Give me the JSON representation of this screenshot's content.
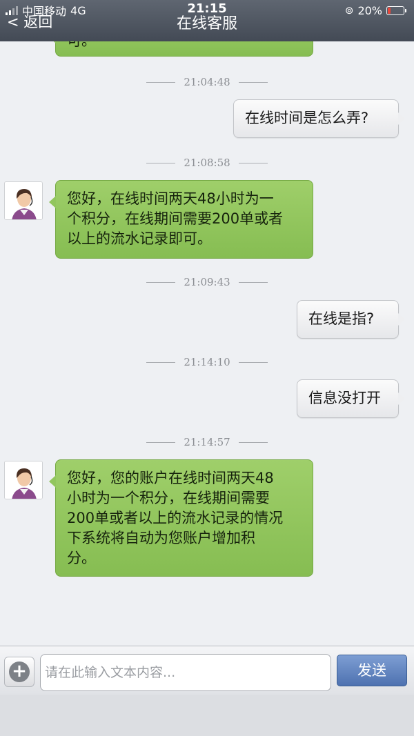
{
  "status_bar": {
    "carrier": "中国移动",
    "network": "4G",
    "time": "21:15",
    "battery": "20%",
    "battery_level": 0.2
  },
  "header": {
    "back_label": "< 返回",
    "title": "在线客服"
  },
  "messages": [
    {
      "type": "agent",
      "text": "可。"
    },
    {
      "type": "timestamp",
      "text": "21:04:48"
    },
    {
      "type": "user",
      "text": "在线时间是怎么弄?"
    },
    {
      "type": "timestamp",
      "text": "21:08:58"
    },
    {
      "type": "agent",
      "lines": [
        "您好，在线时间两天48小时为一",
        "个积分，在线期间需要200单或者",
        "以上的流水记录即可。"
      ]
    },
    {
      "type": "timestamp",
      "text": "21:09:43"
    },
    {
      "type": "user",
      "text": "在线是指?"
    },
    {
      "type": "timestamp",
      "text": "21:14:10"
    },
    {
      "type": "user",
      "text": "信息没打开"
    },
    {
      "type": "timestamp",
      "text": "21:14:57"
    },
    {
      "type": "agent",
      "lines": [
        "您好，您的账户在线时间两天48",
        "小时为一个积分，在线期间需要",
        "200单或者以上的流水记录的情况",
        "下系统将自动为您账户增加积",
        "分。"
      ]
    }
  ],
  "input_bar": {
    "placeholder": "请在此输入文本内容...",
    "value": "",
    "send_label": "发送"
  },
  "colors": {
    "header": "#4a515c",
    "agent_bubble": "#92c65e",
    "user_bubble": "#f0f1f3",
    "send_button": "#5a7dbb",
    "background": "#eef0f3"
  }
}
